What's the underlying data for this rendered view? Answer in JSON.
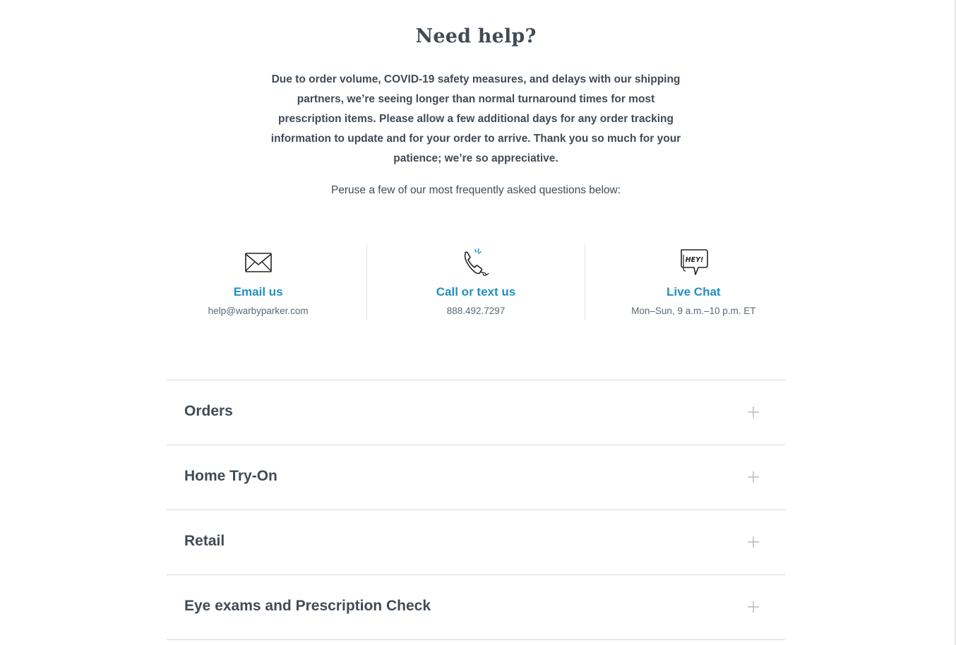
{
  "help": {
    "title": "Need help?",
    "notice": "Due to order volume, COVID-19 safety measures, and delays with our shipping partners, we’re seeing longer than normal turnaround times for most prescription items. Please allow a few additional days for any order tracking information to update and for your order to arrive. Thank you so much for your patience; we’re so appreciative.",
    "peruse": "Peruse a few of our most frequently asked questions below:"
  },
  "contacts": [
    {
      "label": "Email us",
      "detail": "help@warbyparker.com",
      "icon": "envelope-icon"
    },
    {
      "label": "Call or text us",
      "detail": "888.492.7297",
      "icon": "phone-icon"
    },
    {
      "label": "Live Chat",
      "detail": "Mon–Sun, 9 a.m.–10 p.m. ET",
      "icon": "chat-bubble-icon",
      "icon_text": "HEY!"
    }
  ],
  "faq": [
    {
      "label": "Orders"
    },
    {
      "label": "Home Try-On"
    },
    {
      "label": "Retail"
    },
    {
      "label": "Eye exams and Prescription Check"
    }
  ],
  "colors": {
    "accent": "#1f8fc5",
    "text": "#414b56",
    "muted": "#5d6873",
    "divider": "#d6dade"
  }
}
